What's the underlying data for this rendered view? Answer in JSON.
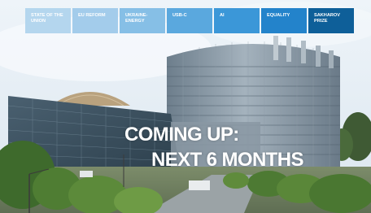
{
  "nav": {
    "tabs": [
      {
        "label": "STATE OF THE UNION"
      },
      {
        "label": "EU REFORM"
      },
      {
        "label": "UKRAINE-ENERGY"
      },
      {
        "label": "USB-C"
      },
      {
        "label": "AI"
      },
      {
        "label": "EQUALITY"
      },
      {
        "label": "SAKHAROV PRIZE"
      }
    ]
  },
  "headline": {
    "line1": "COMING UP:",
    "line2": "NEXT 6 MONTHS"
  },
  "colors": {
    "tab_gradient": [
      "#b4d6ee",
      "#a3cceb",
      "#86bfe6",
      "#5aa8de",
      "#3b97d8",
      "#2383cb",
      "#0e5f99"
    ],
    "headline_text": "#ffffff"
  }
}
